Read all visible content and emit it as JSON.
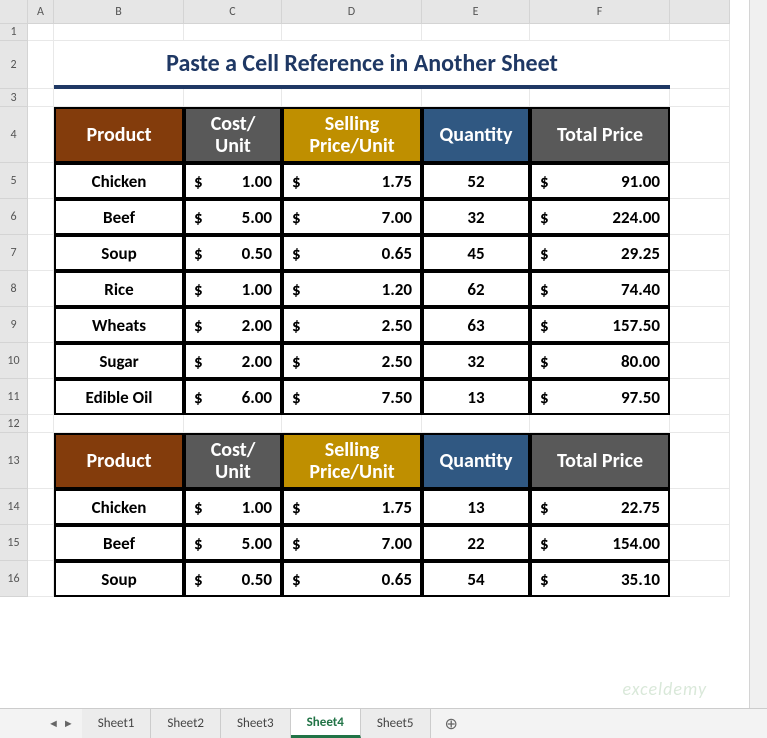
{
  "columns": [
    "A",
    "B",
    "C",
    "D",
    "E",
    "F"
  ],
  "rows": [
    "1",
    "2",
    "3",
    "4",
    "5",
    "6",
    "7",
    "8",
    "9",
    "10",
    "11",
    "12",
    "13",
    "14",
    "15",
    "16"
  ],
  "title": "Paste a Cell Reference in Another Sheet",
  "headers": {
    "product": "Product",
    "cost": "Cost/ Unit",
    "selling": "Selling Price/Unit",
    "qty": "Quantity",
    "total": "Total Price"
  },
  "chart_data": [
    {
      "type": "table",
      "title": "Table 1",
      "columns": [
        "Product",
        "Cost/Unit",
        "Selling Price/Unit",
        "Quantity",
        "Total Price"
      ],
      "rows": [
        {
          "product": "Chicken",
          "cost": 1.0,
          "selling": 1.75,
          "qty": 52,
          "total": 91.0
        },
        {
          "product": "Beef",
          "cost": 5.0,
          "selling": 7.0,
          "qty": 32,
          "total": 224.0
        },
        {
          "product": "Soup",
          "cost": 0.5,
          "selling": 0.65,
          "qty": 45,
          "total": 29.25
        },
        {
          "product": "Rice",
          "cost": 1.0,
          "selling": 1.2,
          "qty": 62,
          "total": 74.4
        },
        {
          "product": "Wheats",
          "cost": 2.0,
          "selling": 2.5,
          "qty": 63,
          "total": 157.5
        },
        {
          "product": "Sugar",
          "cost": 2.0,
          "selling": 2.5,
          "qty": 32,
          "total": 80.0
        },
        {
          "product": "Edible Oil",
          "cost": 6.0,
          "selling": 7.5,
          "qty": 13,
          "total": 97.5
        }
      ]
    },
    {
      "type": "table",
      "title": "Table 2",
      "columns": [
        "Product",
        "Cost/Unit",
        "Selling Price/Unit",
        "Quantity",
        "Total Price"
      ],
      "rows": [
        {
          "product": "Chicken",
          "cost": 1.0,
          "selling": 1.75,
          "qty": 13,
          "total": 22.75
        },
        {
          "product": "Beef",
          "cost": 5.0,
          "selling": 7.0,
          "qty": 22,
          "total": 154.0
        },
        {
          "product": "Soup",
          "cost": 0.5,
          "selling": 0.65,
          "qty": 54,
          "total": 35.1
        }
      ]
    }
  ],
  "table1": [
    {
      "product": "Chicken",
      "cost": "1.00",
      "selling": "1.75",
      "qty": "52",
      "total": "91.00"
    },
    {
      "product": "Beef",
      "cost": "5.00",
      "selling": "7.00",
      "qty": "32",
      "total": "224.00"
    },
    {
      "product": "Soup",
      "cost": "0.50",
      "selling": "0.65",
      "qty": "45",
      "total": "29.25"
    },
    {
      "product": "Rice",
      "cost": "1.00",
      "selling": "1.20",
      "qty": "62",
      "total": "74.40"
    },
    {
      "product": "Wheats",
      "cost": "2.00",
      "selling": "2.50",
      "qty": "63",
      "total": "157.50"
    },
    {
      "product": "Sugar",
      "cost": "2.00",
      "selling": "2.50",
      "qty": "32",
      "total": "80.00"
    },
    {
      "product": "Edible Oil",
      "cost": "6.00",
      "selling": "7.50",
      "qty": "13",
      "total": "97.50"
    }
  ],
  "table2": [
    {
      "product": "Chicken",
      "cost": "1.00",
      "selling": "1.75",
      "qty": "13",
      "total": "22.75"
    },
    {
      "product": "Beef",
      "cost": "5.00",
      "selling": "7.00",
      "qty": "22",
      "total": "154.00"
    },
    {
      "product": "Soup",
      "cost": "0.50",
      "selling": "0.65",
      "qty": "54",
      "total": "35.10"
    }
  ],
  "currency": "$",
  "tabs": [
    "Sheet1",
    "Sheet2",
    "Sheet3",
    "Sheet4",
    "Sheet5"
  ],
  "active_tab": "Sheet4",
  "watermark": "exceldemy",
  "add_icon": "⊕"
}
